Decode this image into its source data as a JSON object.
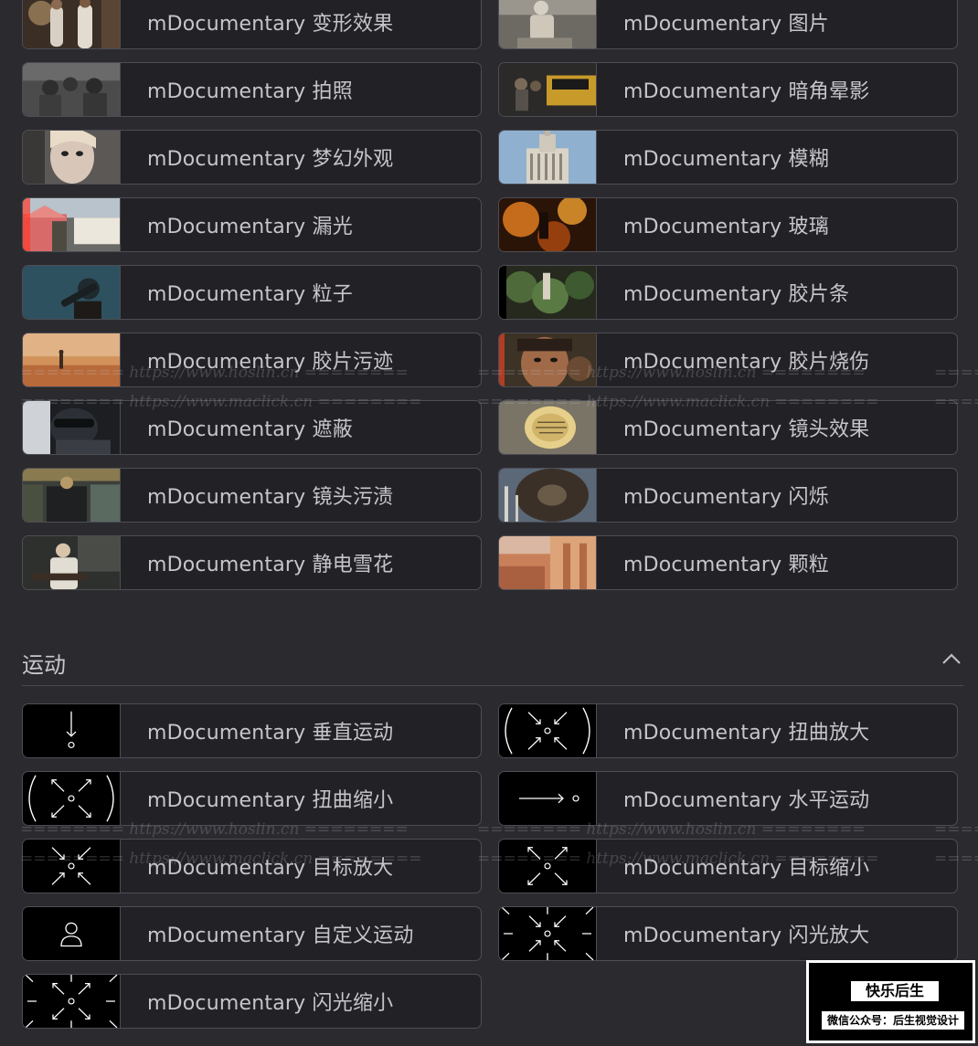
{
  "effects": [
    {
      "label": "mDocumentary 变形效果",
      "thumb": "thumb-deform"
    },
    {
      "label": "mDocumentary 图片",
      "thumb": "thumb-picture"
    },
    {
      "label": "mDocumentary 拍照",
      "thumb": "thumb-photo"
    },
    {
      "label": "mDocumentary 暗角晕影",
      "thumb": "thumb-vignette"
    },
    {
      "label": "mDocumentary 梦幻外观",
      "thumb": "thumb-dreamy"
    },
    {
      "label": "mDocumentary 模糊",
      "thumb": "thumb-blur"
    },
    {
      "label": "mDocumentary 漏光",
      "thumb": "thumb-light-leak"
    },
    {
      "label": "mDocumentary 玻璃",
      "thumb": "thumb-glass"
    },
    {
      "label": "mDocumentary 粒子",
      "thumb": "thumb-particles"
    },
    {
      "label": "mDocumentary 胶片条",
      "thumb": "thumb-film-strip"
    },
    {
      "label": "mDocumentary 胶片污迹",
      "thumb": "thumb-film-stain"
    },
    {
      "label": "mDocumentary 胶片烧伤",
      "thumb": "thumb-film-burn"
    },
    {
      "label": "mDocumentary 遮蔽",
      "thumb": "thumb-mask"
    },
    {
      "label": "mDocumentary 镜头效果",
      "thumb": "thumb-lens-effect"
    },
    {
      "label": "mDocumentary 镜头污渍",
      "thumb": "thumb-lens-dirt"
    },
    {
      "label": "mDocumentary 闪烁",
      "thumb": "thumb-flicker"
    },
    {
      "label": "mDocumentary 静电雪花",
      "thumb": "thumb-static"
    },
    {
      "label": "mDocumentary 颗粒",
      "thumb": "thumb-grain"
    }
  ],
  "motion_section": {
    "title": "运动",
    "collapse_icon": "chevron-up-icon"
  },
  "motion": [
    {
      "label": "mDocumentary 垂直运动",
      "icon": "vertical-move-icon"
    },
    {
      "label": "mDocumentary 扭曲放大",
      "icon": "warp-zoom-in-icon"
    },
    {
      "label": "mDocumentary 扭曲缩小",
      "icon": "warp-zoom-out-icon"
    },
    {
      "label": "mDocumentary 水平运动",
      "icon": "horizontal-move-icon"
    },
    {
      "label": "mDocumentary 目标放大",
      "icon": "target-zoom-in-icon"
    },
    {
      "label": "mDocumentary 目标缩小",
      "icon": "target-zoom-out-icon"
    },
    {
      "label": "mDocumentary 自定义运动",
      "icon": "custom-move-icon"
    },
    {
      "label": "mDocumentary 闪光放大",
      "icon": "flash-zoom-in-icon"
    },
    {
      "label": "mDocumentary 闪光缩小",
      "icon": "flash-zoom-out-icon"
    }
  ],
  "watermarks": {
    "hoslin": "======== https://www.hoslin.cn ========",
    "maclick": "======== https://www.maclick.cn ========"
  },
  "badge": {
    "title": "快乐后生",
    "subtitle": "微信公众号：后生视觉设计"
  }
}
